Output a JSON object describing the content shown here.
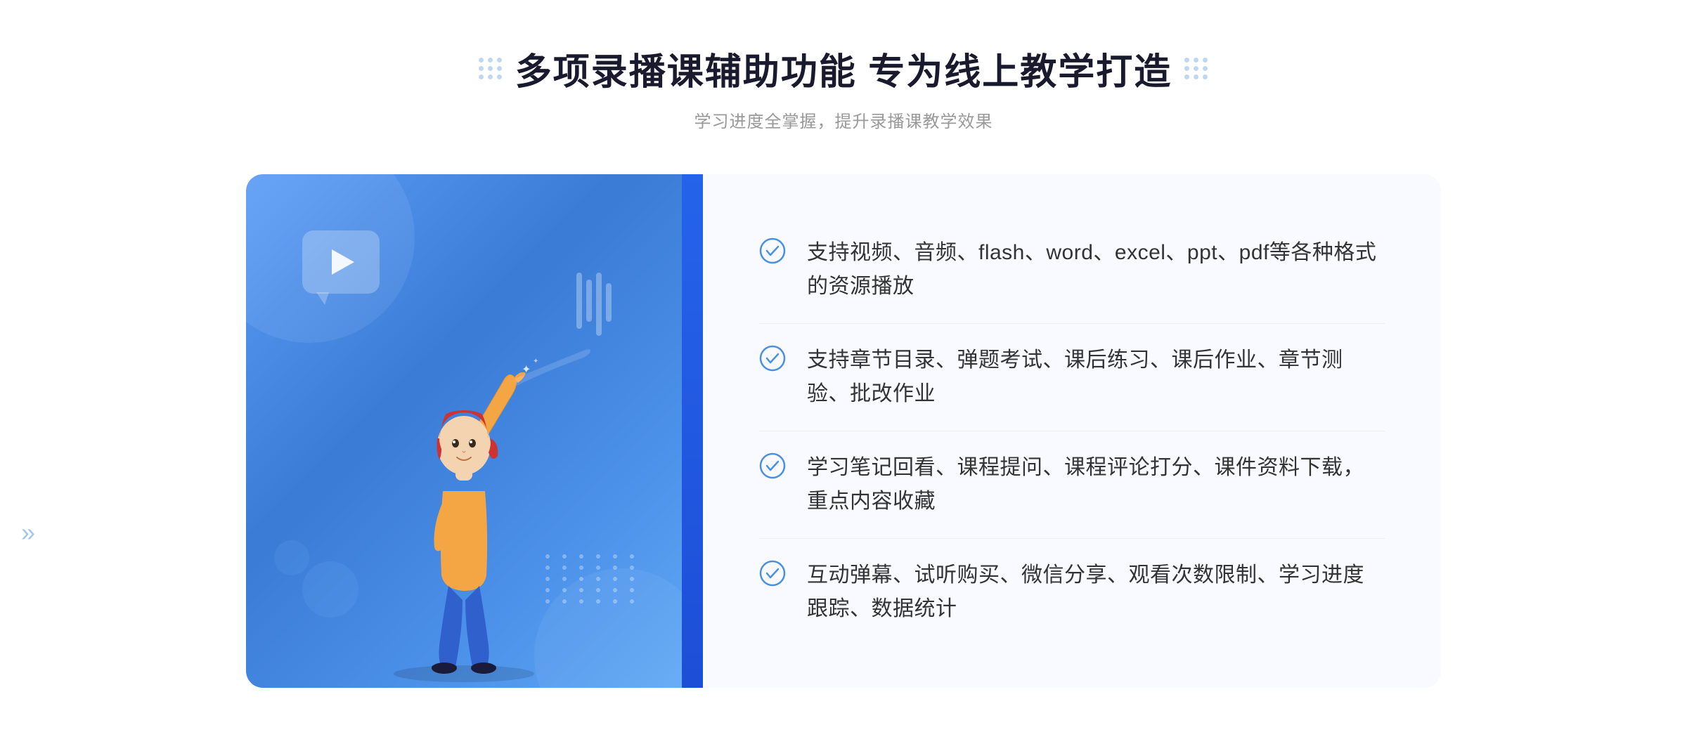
{
  "header": {
    "title": "多项录播课辅助功能 专为线上教学打造",
    "subtitle": "学习进度全掌握，提升录播课教学效果",
    "dots_left": true,
    "dots_right": true
  },
  "features": [
    {
      "id": 1,
      "text": "支持视频、音频、flash、word、excel、ppt、pdf等各种格式的资源播放"
    },
    {
      "id": 2,
      "text": "支持章节目录、弹题考试、课后练习、课后作业、章节测验、批改作业"
    },
    {
      "id": 3,
      "text": "学习笔记回看、课程提问、课程评论打分、课件资料下载，重点内容收藏"
    },
    {
      "id": 4,
      "text": "互动弹幕、试听购买、微信分享、观看次数限制、学习进度跟踪、数据统计"
    }
  ],
  "colors": {
    "primary_blue": "#4a90e2",
    "dark_blue": "#2563eb",
    "title_color": "#1a1a2e",
    "text_color": "#333333",
    "subtitle_color": "#999999",
    "bg_card": "#f8faff"
  },
  "icons": {
    "check_circle": "✓",
    "play": "▶",
    "chevron_right": "»"
  }
}
